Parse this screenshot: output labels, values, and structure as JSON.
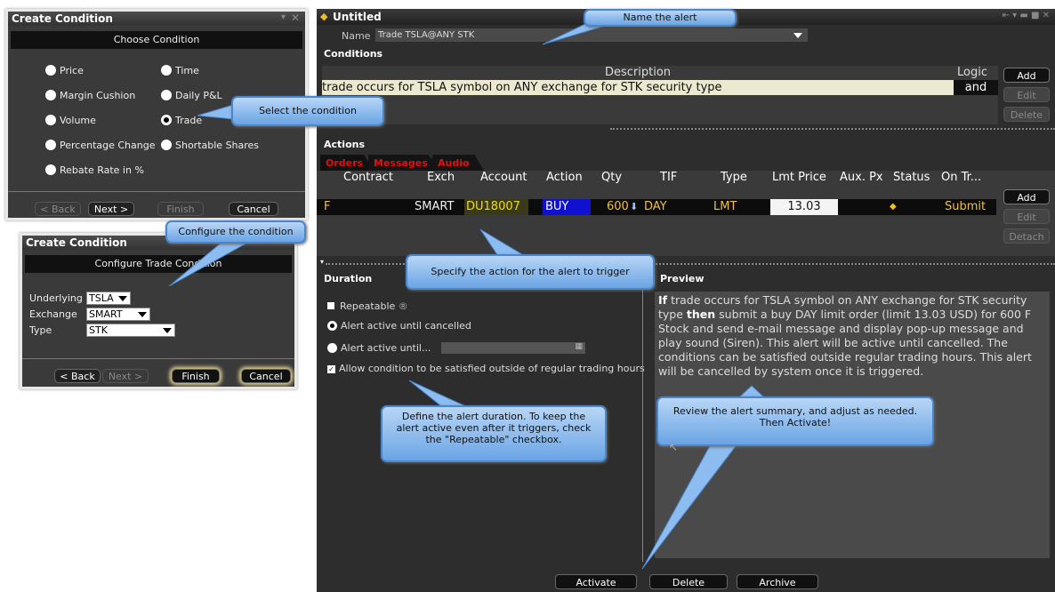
{
  "dlg1": {
    "title": "Create Condition",
    "subtitle": "Choose Condition",
    "options": [
      "Price",
      "Time",
      "Margin Cushion",
      "Daily P&L",
      "Volume",
      "Trade",
      "Percentage Change",
      "Shortable Shares",
      "Rebate Rate in %"
    ],
    "back": "< Back",
    "next": "Next >",
    "finish": "Finish",
    "cancel": "Cancel"
  },
  "dlg2": {
    "title": "Create Condition",
    "subtitle": "Configure Trade Condition",
    "labels": {
      "underlying": "Underlying",
      "exchange": "Exchange",
      "type": "Type"
    },
    "values": {
      "underlying": "TSLA",
      "exchange": "SMART",
      "type": "STK"
    },
    "back": "< Back",
    "next": "Next >",
    "finish": "Finish",
    "cancel": "Cancel"
  },
  "main": {
    "title": "Untitled",
    "name_label": "Name",
    "name_value": "Trade TSLA@ANY STK",
    "conditions_label": "Conditions",
    "description_header": "Description",
    "logic_header": "Logic",
    "condition_row": "trade occurs for TSLA symbol on ANY exchange for STK security type",
    "condition_logic": "and",
    "cond_buttons": {
      "add": "Add",
      "edit": "Edit",
      "delete": "Delete"
    },
    "actions_label": "Actions",
    "tabs": [
      "Orders",
      "Messages",
      "Audio"
    ],
    "order_headers": [
      "Contract",
      "Exch",
      "Account",
      "Action",
      "Qty",
      "TIF",
      "Type",
      "Lmt Price",
      "Aux. Px",
      "Status",
      "On Tr..."
    ],
    "order_row": {
      "contract": "F",
      "exch": "SMART",
      "account": "DU18007",
      "action": "BUY",
      "qty": "600",
      "tif": "DAY",
      "type": "LMT",
      "lmt": "13.03",
      "status": "Submit"
    },
    "order_buttons": {
      "add": "Add",
      "edit": "Edit",
      "detach": "Detach"
    },
    "duration_label": "Duration",
    "repeatable": "Repeatable",
    "until_cancelled": "Alert active until cancelled",
    "until": "Alert active until...",
    "allow_outside": "Allow condition to be satisfied outside of regular trading hours",
    "preview_label": "Preview",
    "preview": {
      "p1": "If",
      "p2": " trade occurs for TSLA symbol on ANY exchange for STK security type ",
      "p3": "then",
      "p4": " submit a buy DAY limit order (limit 13.03 USD) for 600 F Stock and send e-mail message and display pop-up message and play sound (Siren). This alert will be active until cancelled. The conditions can be satisfied outside regular trading hours. This alert will be cancelled by system once it is triggered."
    },
    "bottom": {
      "activate": "Activate",
      "delete": "Delete",
      "archive": "Archive"
    }
  },
  "callouts": {
    "name": "Name the alert",
    "select": "Select the condition",
    "configure": "Configure the condition",
    "action": "Specify the action for the alert to trigger",
    "duration": "Define the alert duration. To keep the alert active even after it triggers, check the \"Repeatable\" checkbox.",
    "review": "Review the alert summary, and adjust as needed. Then Activate!"
  },
  "colors": {
    "accent_callout": "#6aa4e4",
    "tab_red": "#e01010",
    "account_yellow": "#f0e000",
    "buy_blue": "#1010d0",
    "row_bg": "#ece9d0"
  }
}
